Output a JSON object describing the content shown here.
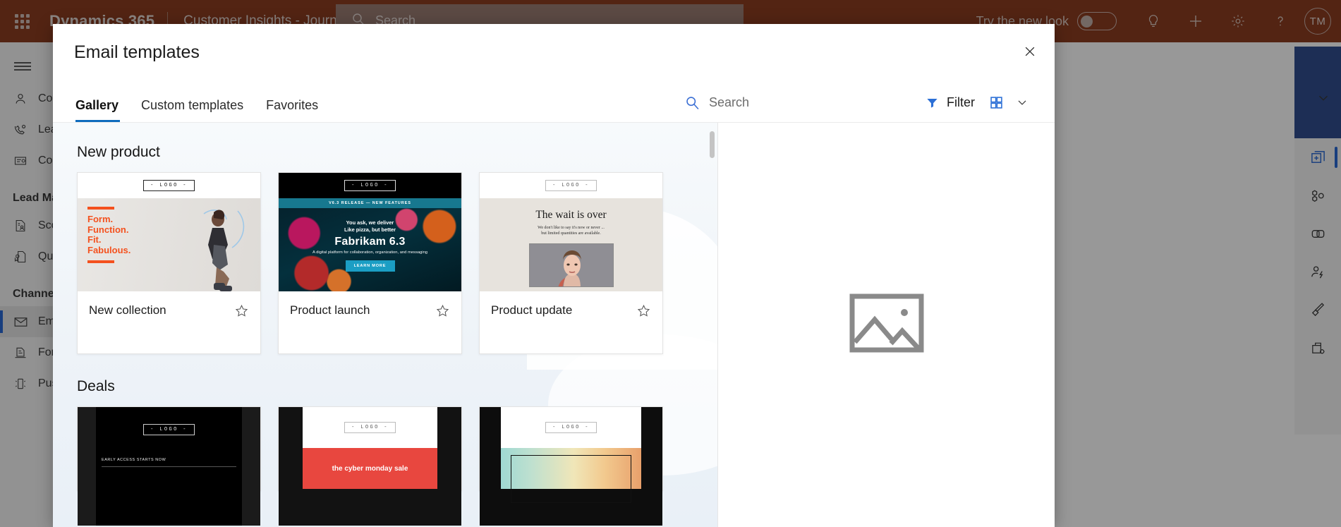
{
  "app": {
    "brand": "Dynamics 365",
    "app_name": "Customer Insights - Journeys",
    "search_placeholder": "Search",
    "try_new_look": "Try the new look",
    "avatar_initials": "TM",
    "icons": {
      "waffle": "app-launcher-icon",
      "search": "search-icon",
      "lightbulb": "lightbulb-icon",
      "plus": "plus-icon",
      "gear": "gear-icon",
      "help": "question-mark-icon"
    }
  },
  "sidebar": {
    "items": [
      {
        "label": "Contacts",
        "icon": "person-icon",
        "type": "item",
        "selected": false
      },
      {
        "label": "Leads",
        "icon": "phone-gear-icon",
        "type": "item",
        "selected": false
      },
      {
        "label": "Contracts",
        "icon": "certificate-icon",
        "type": "item",
        "selected": false
      },
      {
        "label": "Lead Management",
        "icon": "",
        "type": "group",
        "selected": false
      },
      {
        "label": "Scoring models",
        "icon": "score-document-icon",
        "type": "item",
        "selected": false
      },
      {
        "label": "Qualification",
        "icon": "qualification-icon",
        "type": "item",
        "selected": false
      },
      {
        "label": "Channels",
        "icon": "",
        "type": "group",
        "selected": false
      },
      {
        "label": "Emails",
        "icon": "envelope-icon",
        "type": "item",
        "selected": true
      },
      {
        "label": "Forms",
        "icon": "form-icon",
        "type": "item",
        "selected": false
      },
      {
        "label": "Push notifications",
        "icon": "push-icon",
        "type": "item",
        "selected": false
      }
    ]
  },
  "right_rail": {
    "items": [
      {
        "icon": "add-element-icon",
        "selected": true
      },
      {
        "icon": "elements-icon",
        "selected": false
      },
      {
        "icon": "layouts-icon",
        "selected": false
      },
      {
        "icon": "personalization-icon",
        "selected": false
      },
      {
        "icon": "brush-theme-icon",
        "selected": false
      },
      {
        "icon": "settings-panel-icon",
        "selected": false
      }
    ]
  },
  "modal": {
    "title": "Email templates",
    "close_icon": "close-icon",
    "tabs": [
      {
        "label": "Gallery",
        "active": true
      },
      {
        "label": "Custom templates",
        "active": false
      },
      {
        "label": "Favorites",
        "active": false
      }
    ],
    "toolbar": {
      "search_placeholder": "Search",
      "search_icon": "search-icon",
      "filter_label": "Filter",
      "filter_icon": "funnel-icon",
      "view_icon": "grid-view-icon",
      "chevron_icon": "chevron-down-icon",
      "accent_color": "#0f6cbd"
    },
    "sections": [
      {
        "title": "New product",
        "cards": [
          {
            "name": "New collection",
            "star_icon": "star-outline-icon",
            "preview": {
              "logo": "- LOGO -",
              "headline_lines": [
                "Form.",
                "Function.",
                "Fit.",
                "Fabulous."
              ],
              "accent": "#f4511e"
            }
          },
          {
            "name": "Product launch",
            "star_icon": "star-outline-icon",
            "preview": {
              "logo": "- LOGO -",
              "banner": "V6.3 RELEASE — NEW FEATURES",
              "line1": "You ask, we deliver",
              "line2": "Like pizza, but better",
              "title": "Fabrikam 6.3",
              "subtitle": "A digital platform for collaboration, organization, and messaging",
              "cta": "LEARN MORE",
              "accent": "#1b9ec4"
            }
          },
          {
            "name": "Product update",
            "star_icon": "star-outline-icon",
            "preview": {
              "logo": "- LOGO -",
              "headline": "The wait is over",
              "sub1": "We don't like to say it's now or never ...",
              "sub2": "but limited quantities are available."
            }
          }
        ]
      },
      {
        "title": "Deals",
        "cards": [
          {
            "name": "",
            "star_icon": "star-outline-icon",
            "preview": {
              "logo": "- LOGO -",
              "caption": "EARLY ACCESS STARTS NOW"
            }
          },
          {
            "name": "",
            "star_icon": "star-outline-icon",
            "preview": {
              "logo": "- LOGO -",
              "caption": "the cyber monday sale",
              "accent": "#e8473f"
            }
          },
          {
            "name": "",
            "star_icon": "star-outline-icon",
            "preview": {
              "logo": "- LOGO -",
              "caption": ""
            }
          }
        ]
      }
    ],
    "preview_pane": {
      "placeholder_icon": "image-placeholder-icon"
    }
  }
}
